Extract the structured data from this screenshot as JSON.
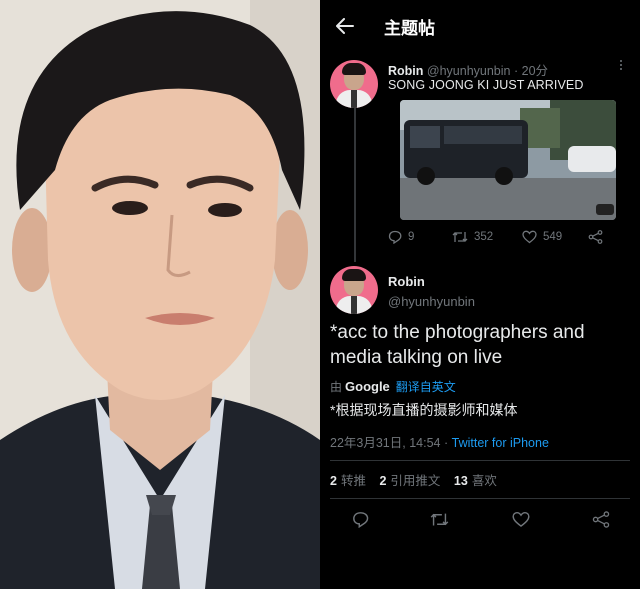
{
  "header": {
    "title": "主题帖"
  },
  "tweet1": {
    "name": "Robin",
    "handle": "@hyunhyunbin",
    "time": "20分",
    "text": "SONG JOONG KI JUST ARRIVED",
    "replies": "9",
    "retweets": "352",
    "likes": "549"
  },
  "tweet2": {
    "name": "Robin",
    "handle": "@hyunhyunbin",
    "text": "*acc to the photographers and media talking on live",
    "translate": {
      "by": "由",
      "google": "Google",
      "link": "翻译自英文"
    },
    "translated_text": "*根据现场直播的摄影师和媒体",
    "date": "22年3月31日, 14:54",
    "separator": "·",
    "source": "Twitter for iPhone",
    "stats": {
      "retweets": "2",
      "retweets_label": "转推",
      "quotes": "2",
      "quotes_label": "引用推文",
      "likes": "13",
      "likes_label": "喜欢"
    }
  },
  "colors": {
    "accent": "#1d9bf0",
    "muted": "#71767b",
    "avatar_bg": "#f06c8c"
  },
  "icons": [
    "back-arrow-icon",
    "more-icon",
    "reply-icon",
    "retweet-icon",
    "like-icon",
    "share-icon"
  ]
}
